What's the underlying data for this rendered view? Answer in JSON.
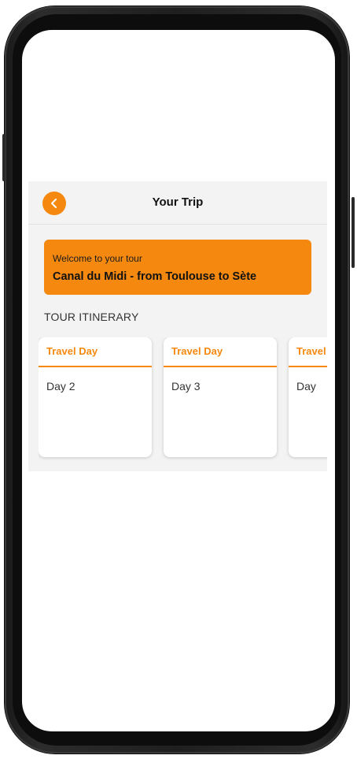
{
  "header": {
    "title": "Your Trip",
    "back_icon": "chevron-left-icon"
  },
  "welcome": {
    "greeting": "Welcome to your tour",
    "tour_name": "Canal du Midi - from Toulouse to Sète"
  },
  "itinerary": {
    "section_title": "TOUR ITINERARY",
    "days": [
      {
        "type": "Travel Day",
        "label": "Day 2"
      },
      {
        "type": "Travel Day",
        "label": "Day 3"
      },
      {
        "type": "Travel Day",
        "label": "Day"
      }
    ]
  },
  "colors": {
    "accent": "#f5890f",
    "background": "#f3f3f3",
    "card": "#ffffff"
  }
}
